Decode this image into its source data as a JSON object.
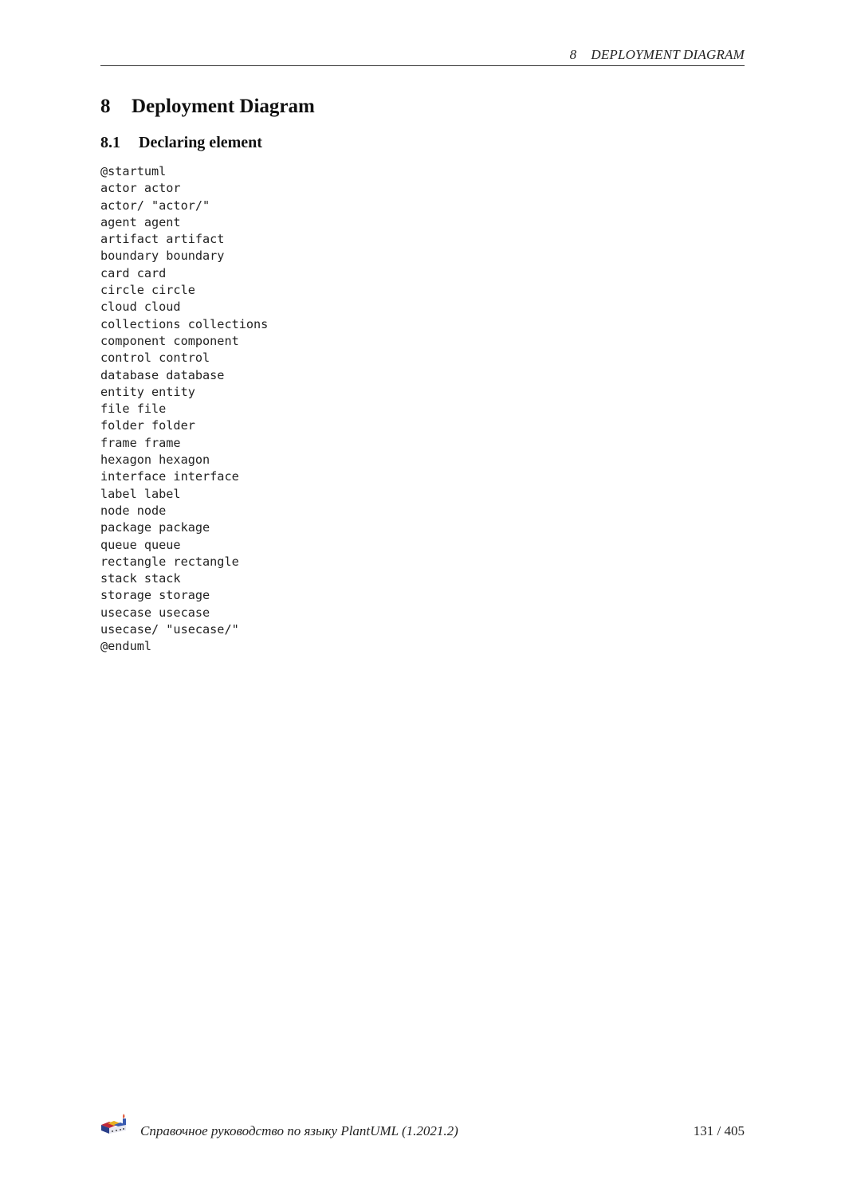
{
  "header": {
    "chapter_number": "8",
    "chapter_title": "DEPLOYMENT DIAGRAM"
  },
  "section": {
    "number": "8",
    "title": "Deployment Diagram"
  },
  "subsection": {
    "number": "8.1",
    "title": "Declaring element"
  },
  "code_lines": [
    "@startuml",
    "actor actor",
    "actor/ \"actor/\"",
    "agent agent",
    "artifact artifact",
    "boundary boundary",
    "card card",
    "circle circle",
    "cloud cloud",
    "collections collections",
    "component component",
    "control control",
    "database database",
    "entity entity",
    "file file",
    "folder folder",
    "frame frame",
    "hexagon hexagon",
    "interface interface",
    "label label",
    "node node",
    "package package",
    "queue queue",
    "rectangle rectangle",
    "stack stack",
    "storage storage",
    "usecase usecase",
    "usecase/ \"usecase/\"",
    "@enduml"
  ],
  "footer": {
    "logo_icon": "plantuml-logo-icon",
    "title": "Справочное руководство по языку PlantUML (1.2021.2)",
    "page": "131 / 405"
  }
}
